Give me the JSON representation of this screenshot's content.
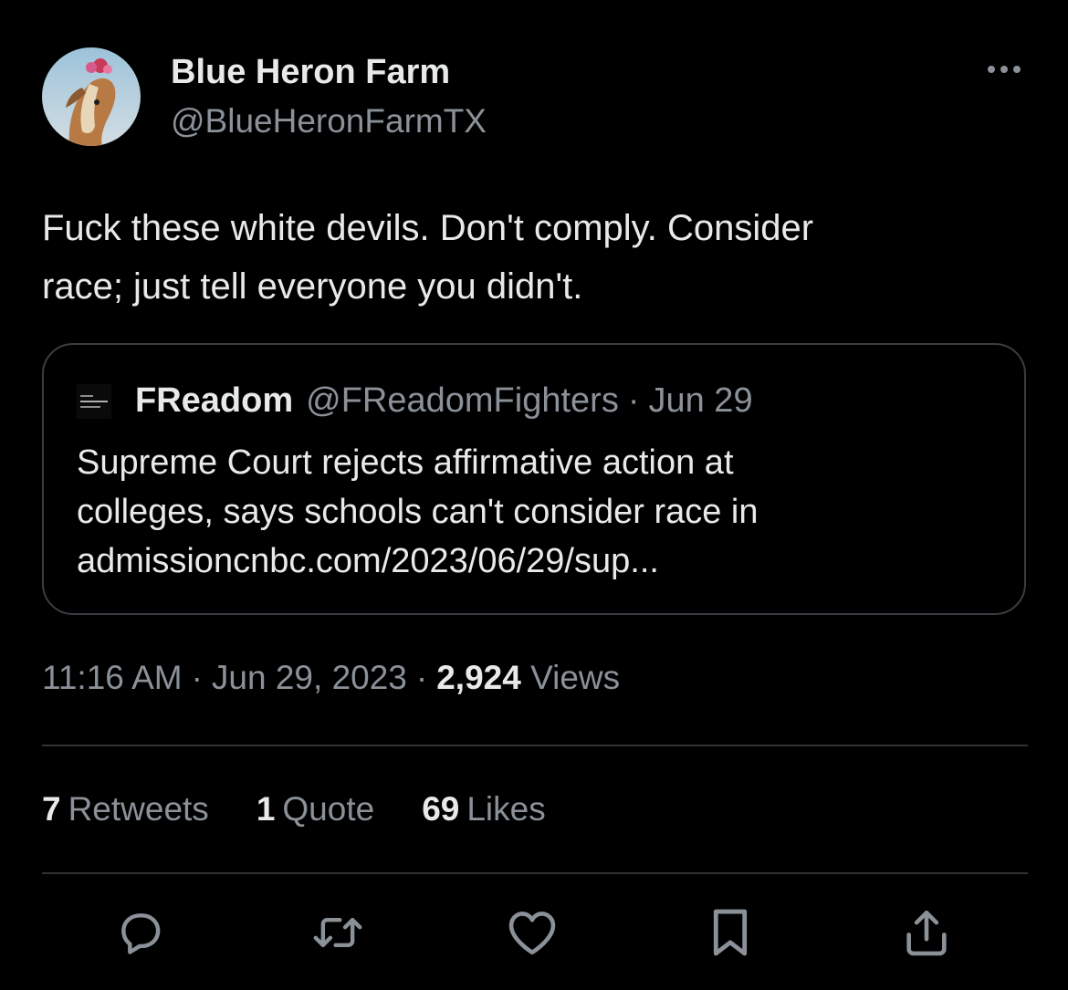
{
  "author": {
    "display_name": "Blue Heron Farm",
    "handle": "@BlueHeronFarmTX"
  },
  "tweet": {
    "text_line1": "Fuck these white devils. Don't comply. Consider",
    "text_line2": "race; just tell everyone you didn't."
  },
  "quoted": {
    "name": "FReadom",
    "handle": "@FReadomFighters",
    "separator": "·",
    "date": "Jun 29",
    "text_line1": "Supreme Court rejects affirmative action at",
    "text_line2": "colleges, says schools can't consider race in",
    "text_line3": "admissioncnbc.com/2023/06/29/sup..."
  },
  "meta": {
    "time": "11:16 AM",
    "separator": "·",
    "date": "Jun 29, 2023",
    "views_count": "2,924",
    "views_label": "Views"
  },
  "stats": {
    "retweets_count": "7",
    "retweets_label": "Retweets",
    "quotes_count": "1",
    "quotes_label": "Quote",
    "likes_count": "69",
    "likes_label": "Likes"
  },
  "icons": {
    "reply": "reply-icon",
    "retweet": "retweet-icon",
    "like": "heart-icon",
    "bookmark": "bookmark-icon",
    "share": "share-icon",
    "more": "more-icon"
  },
  "colors": {
    "background": "#000000",
    "text_primary": "#e7e9ea",
    "text_secondary": "#8b9198",
    "border": "#2f3336"
  }
}
